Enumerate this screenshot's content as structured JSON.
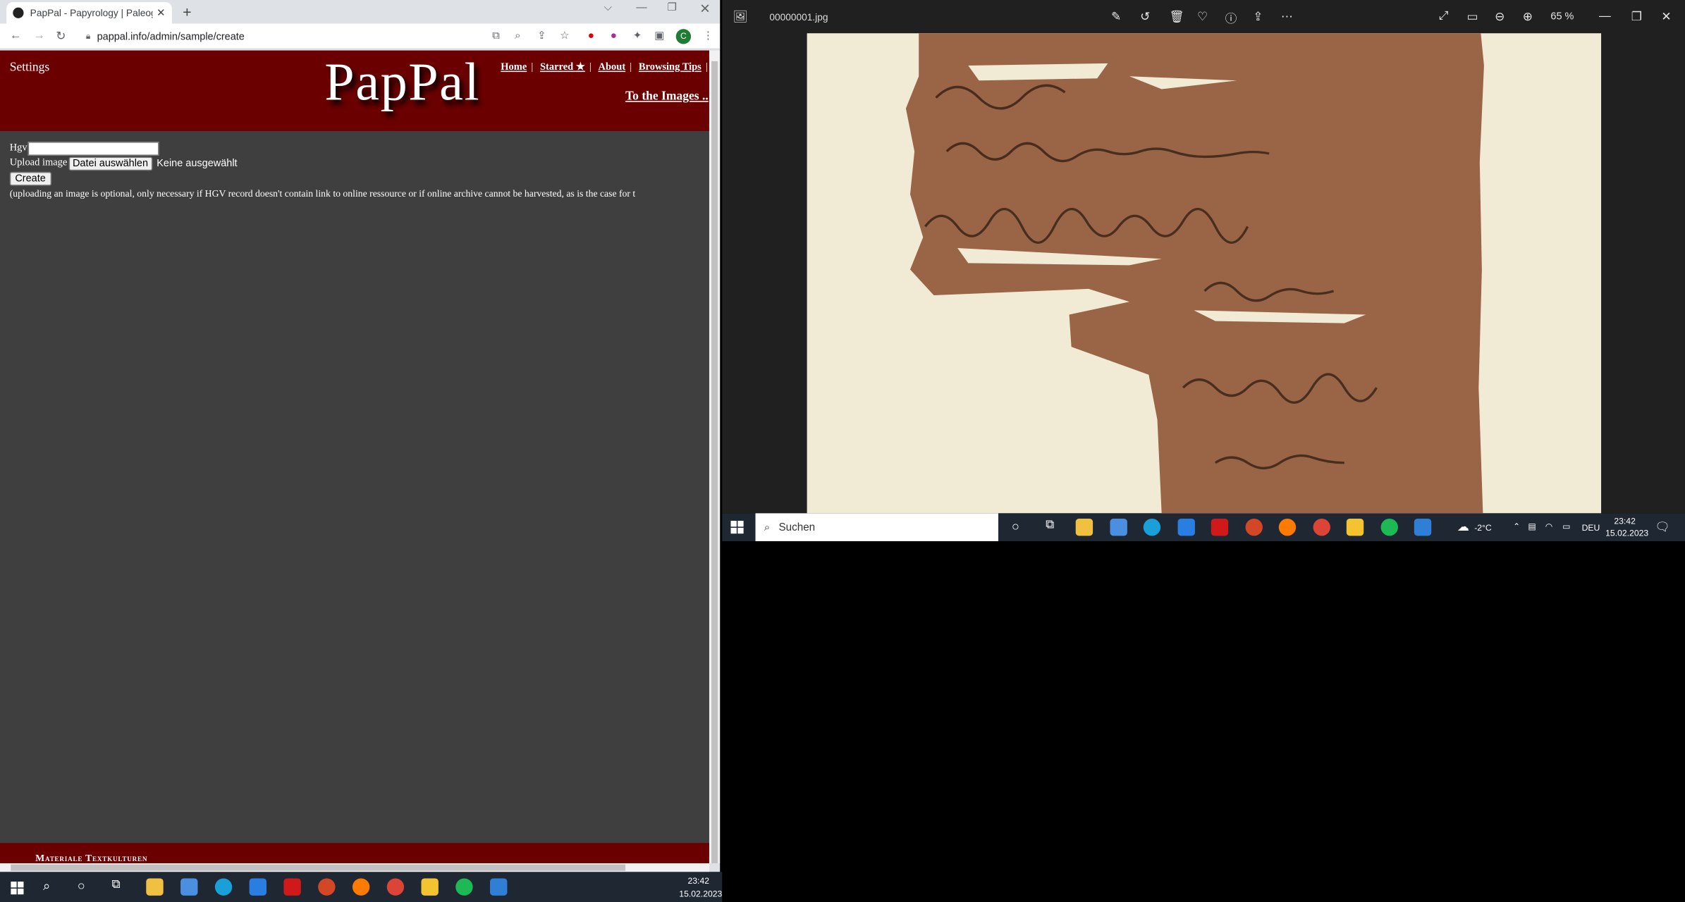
{
  "browser": {
    "tab_title": "PapPal - Papyrology | Paleograph",
    "url": "pappal.info/admin/sample/create"
  },
  "page": {
    "settings": "Settings",
    "logo": "PapPal",
    "nav": [
      "Home",
      "Starred ★",
      "About",
      "Browsing Tips"
    ],
    "to_images": "To the Images ..",
    "hgv_label": "Hgv",
    "upload_label": "Upload image",
    "file_button": "Datei auswählen",
    "no_file": "Keine ausgewählt",
    "create_button": "Create",
    "note": "(uploading an image is optional, only necessary if HGV record doesn't contain link to online ressource or if online archive cannot be harvested, as is the case for t",
    "footer": "Materiale Textkulturen"
  },
  "viewer": {
    "filename": "00000001.jpg",
    "zoom": "65 %"
  },
  "taskbar_right": {
    "search_placeholder": "Suchen",
    "weather": "-2°C",
    "lang": "DEU",
    "time": "23:42",
    "date": "15.02.2023"
  },
  "taskbar_left": {
    "time": "23:42",
    "date": "15.02.2023"
  },
  "colors": {
    "banner": "#6b0000",
    "page_bg": "#3f3f3f",
    "taskbar": "#1f2733",
    "papyrus": "#9a6446"
  }
}
